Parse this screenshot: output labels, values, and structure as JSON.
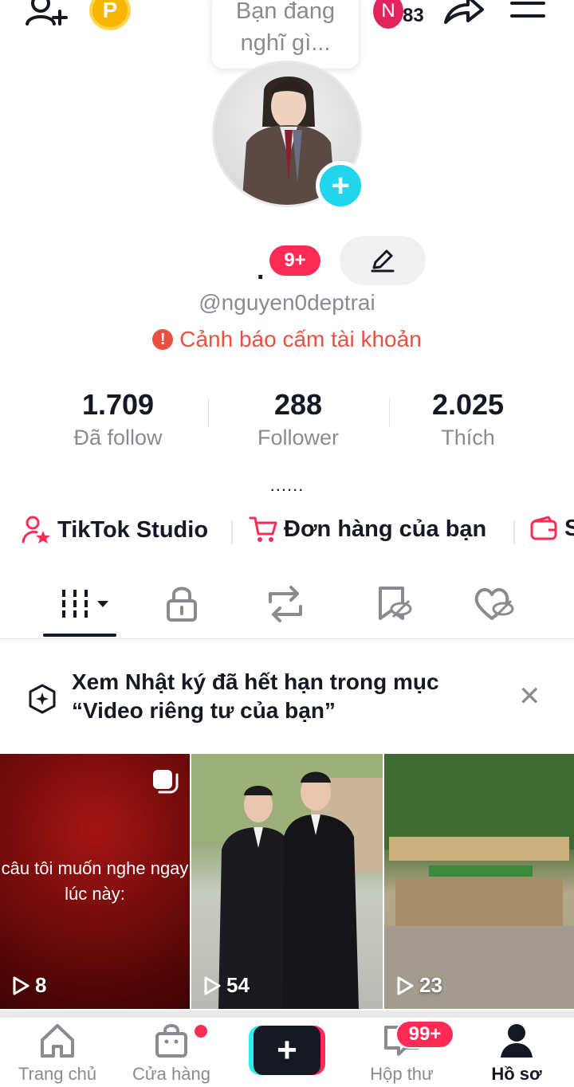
{
  "header": {
    "coin_letter": "P",
    "status_bubble": "Bạn đang nghĩ gì...",
    "notif_avatar_letter": "N",
    "notif_count": "83"
  },
  "profile": {
    "display_name": ".",
    "name_badge": "9+",
    "username": "@nguyen0deptrai",
    "warning": "Cảnh báo cấm tài khoản",
    "warning_icon": "!",
    "bio": "......"
  },
  "stats": [
    {
      "value": "1.709",
      "label": "Đã follow"
    },
    {
      "value": "288",
      "label": "Follower"
    },
    {
      "value": "2.025",
      "label": "Thích"
    }
  ],
  "shortcuts": [
    {
      "label": "TikTok Studio",
      "icon": "creator-icon"
    },
    {
      "label": "Đơn hàng của bạn",
      "icon": "cart-icon"
    },
    {
      "label": "S",
      "icon": "wallet-icon"
    }
  ],
  "content_tabs": [
    "videos-grid",
    "private",
    "reposts",
    "favorites",
    "liked"
  ],
  "notice": {
    "line1": "Xem Nhật ký đã hết hạn trong mục",
    "line2": "“Video riêng tư của bạn”"
  },
  "videos": [
    {
      "views": "8",
      "caption": "câu tôi muốn nghe ngay lúc này:"
    },
    {
      "views": "54"
    },
    {
      "views": "23"
    }
  ],
  "bottom_nav": {
    "home": "Trang chủ",
    "shop": "Cửa hàng",
    "inbox": "Hộp thư",
    "inbox_badge": "99+",
    "profile": "Hồ sơ"
  },
  "colors": {
    "accent_red": "#fe2c55",
    "accent_cyan": "#20d5ec",
    "warning": "#e9503f"
  }
}
